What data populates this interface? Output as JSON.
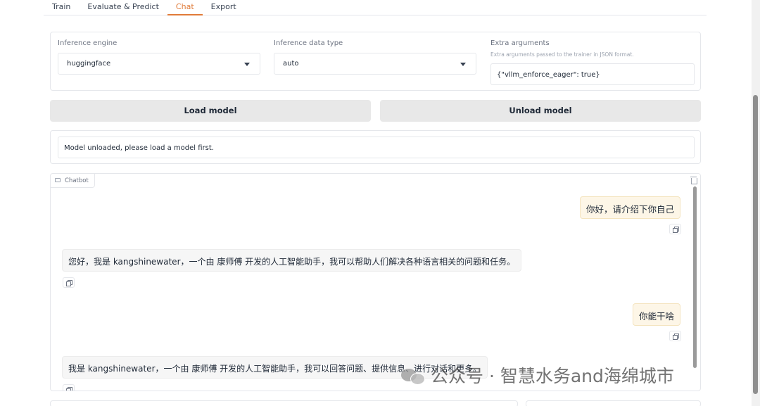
{
  "tabs": [
    {
      "label": "Train"
    },
    {
      "label": "Evaluate & Predict"
    },
    {
      "label": "Chat",
      "active": true
    },
    {
      "label": "Export"
    }
  ],
  "settings": {
    "inference_engine": {
      "label": "Inference engine",
      "value": "huggingface"
    },
    "inference_dtype": {
      "label": "Inference data type",
      "value": "auto"
    },
    "extra_args": {
      "label": "Extra arguments",
      "description": "Extra arguments passed to the trainer in JSON format.",
      "value": "{\"vllm_enforce_eager\": true}"
    }
  },
  "buttons": {
    "load": "Load model",
    "unload": "Unload model"
  },
  "status": {
    "text": "Model unloaded, please load a model first."
  },
  "chatbot": {
    "label": "Chatbot",
    "messages": [
      {
        "role": "user",
        "text": "你好，请介绍下你自己"
      },
      {
        "role": "assistant",
        "text": "您好，我是 kangshinewater，一个由 康师傅 开发的人工智能助手，我可以帮助人们解决各种语言相关的问题和任务。"
      },
      {
        "role": "user",
        "text": "你能干啥"
      },
      {
        "role": "assistant",
        "text": "我是 kangshinewater，一个由 康师傅 开发的人工智能助手，我可以回答问题、提供信息、进行对话和更多。"
      }
    ]
  },
  "watermark": {
    "text": "公众号 · 智慧水务and海绵城市",
    "icon": "wechat-icon"
  },
  "colors": {
    "accent": "#e07b39",
    "user_bubble": "#fdf6e7",
    "bot_bubble": "#f6f6f6",
    "button_bg": "#e8e8e8"
  }
}
